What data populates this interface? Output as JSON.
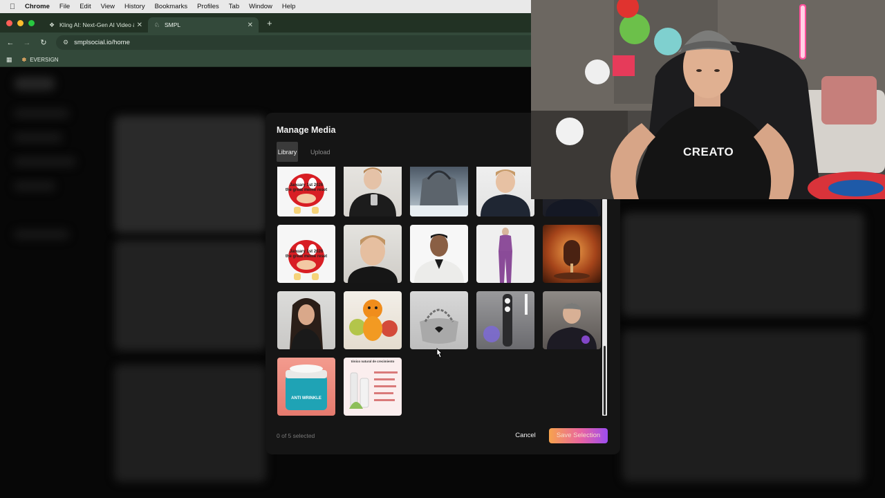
{
  "menubar": {
    "app": "Chrome",
    "items": [
      "File",
      "Edit",
      "View",
      "History",
      "Bookmarks",
      "Profiles",
      "Tab",
      "Window",
      "Help"
    ]
  },
  "browser": {
    "tabs": [
      {
        "label": "Kling AI: Next-Gen AI Video &",
        "icon": "kling-icon",
        "active": false
      },
      {
        "label": "SMPL",
        "icon": "smpl-icon",
        "active": true
      }
    ],
    "url": "smplsocial.io/home",
    "bookmark": "EVERSIGN",
    "theme_color": "#33493a"
  },
  "modal": {
    "title": "Manage Media",
    "tabs": [
      "Library",
      "Upload"
    ],
    "active_tab": "Library",
    "selection_status": "0 of 5 selected",
    "cancel_label": "Cancel",
    "save_label": "Save Selection",
    "meme_caption_line1": "January 1st 2026",
    "meme_caption_line2": "the great meme reset",
    "media": [
      {
        "id": "knuckles-meme-1",
        "kind": "meme"
      },
      {
        "id": "boy-phone",
        "kind": "photo"
      },
      {
        "id": "grey-bag-snow",
        "kind": "photo"
      },
      {
        "id": "boy-portrait",
        "kind": "photo"
      },
      {
        "id": "partial-dark",
        "kind": "photo"
      },
      {
        "id": "knuckles-meme-2",
        "kind": "meme"
      },
      {
        "id": "boy-closeup",
        "kind": "photo"
      },
      {
        "id": "man-white-jacket",
        "kind": "photo"
      },
      {
        "id": "purple-outfit",
        "kind": "photo"
      },
      {
        "id": "chocolate-splash",
        "kind": "photo"
      },
      {
        "id": "woman-portrait",
        "kind": "photo"
      },
      {
        "id": "orange-fruit-figure",
        "kind": "photo"
      },
      {
        "id": "silver-bag",
        "kind": "photo"
      },
      {
        "id": "speaker-device",
        "kind": "photo"
      },
      {
        "id": "man-cap-hoodie",
        "kind": "photo"
      },
      {
        "id": "anti-wrinkle-cream",
        "kind": "photo"
      },
      {
        "id": "hair-tonic-infographic",
        "kind": "photo"
      }
    ],
    "cream_label": "ANTI WRINKLE",
    "tonic_title": "tónico natural de crecimiento"
  },
  "webcam": {
    "shirt_text": "CREATO"
  }
}
